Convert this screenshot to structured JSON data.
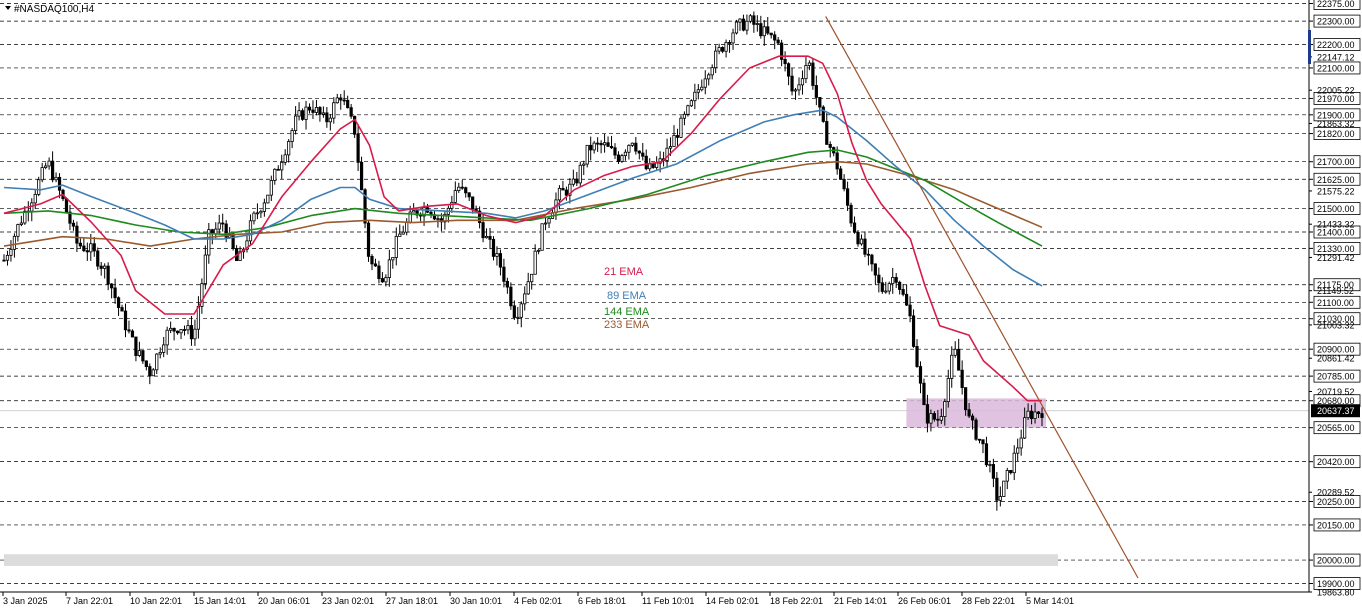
{
  "chart_data": {
    "type": "candlestick",
    "symbol": "#NASDAQ100,H4",
    "ylim": [
      19863.8,
      22390
    ],
    "colors": {
      "background": "#ffffff",
      "candle": "#000000",
      "ema21": "#d81b4a",
      "ema89": "#3f7fb5",
      "ema144": "#1f8a1f",
      "ema233": "#9a5a2e",
      "trendline": "#a0522d",
      "zone": "#d9b8dc",
      "support_band": "#dcdcdc",
      "price_marker": "#000000"
    },
    "x_labels": [
      "3 Jan 2025",
      "7 Jan 22:01",
      "10 Jan 22:01",
      "15 Jan 14:01",
      "20 Jan 06:01",
      "23 Jan 02:01",
      "27 Jan 18:01",
      "30 Jan 10:01",
      "4 Feb 02:01",
      "6 Feb 18:01",
      "11 Feb 10:01",
      "14 Feb 02:01",
      "18 Feb 22:01",
      "21 Feb 14:01",
      "26 Feb 06:01",
      "28 Feb 22:01",
      "5 Mar 14:01"
    ],
    "level_labels": [
      "22375.00",
      "22300.00",
      "22200.00",
      "22100.00",
      "21970.00",
      "21900.00",
      "21820.00",
      "21700.00",
      "21625.00",
      "21500.00",
      "21400.00",
      "21330.00",
      "21175.00",
      "21100.00",
      "21030.00",
      "20900.00",
      "20785.00",
      "20680.00",
      "20565.00",
      "20420.00",
      "20250.00",
      "20150.00",
      "20000.00",
      "19900.00"
    ],
    "tick_labels": [
      "22147.12",
      "22005.22",
      "21863.32",
      "21575.22",
      "21433.32",
      "21291.42",
      "21149.52",
      "21003.32",
      "20861.42",
      "20719.52",
      "20289.52",
      "19863.80"
    ],
    "current_price": "20637.37",
    "legend": [
      {
        "key": "ema21",
        "label": "21 EMA"
      },
      {
        "key": "ema89",
        "label": "89 EMA"
      },
      {
        "key": "ema144",
        "label": "144 EMA"
      },
      {
        "key": "ema233",
        "label": "233 EMA"
      }
    ],
    "close_path": [
      [
        0,
        21280
      ],
      [
        2,
        21430
      ],
      [
        4,
        21560
      ],
      [
        6,
        21700
      ],
      [
        8,
        21540
      ],
      [
        10,
        21350
      ],
      [
        12,
        21320
      ],
      [
        14,
        21230
      ],
      [
        16,
        21050
      ],
      [
        18,
        20900
      ],
      [
        20,
        20800
      ],
      [
        22,
        20960
      ],
      [
        24,
        21000
      ],
      [
        26,
        20960
      ],
      [
        28,
        21380
      ],
      [
        30,
        21440
      ],
      [
        32,
        21260
      ],
      [
        34,
        21450
      ],
      [
        36,
        21560
      ],
      [
        38,
        21720
      ],
      [
        40,
        21880
      ],
      [
        42,
        21940
      ],
      [
        44,
        21870
      ],
      [
        46,
        21990
      ],
      [
        48,
        21830
      ],
      [
        50,
        21270
      ],
      [
        52,
        21210
      ],
      [
        54,
        21380
      ],
      [
        56,
        21480
      ],
      [
        58,
        21510
      ],
      [
        60,
        21440
      ],
      [
        62,
        21600
      ],
      [
        64,
        21520
      ],
      [
        66,
        21370
      ],
      [
        68,
        21250
      ],
      [
        70,
        21040
      ],
      [
        72,
        21220
      ],
      [
        74,
        21450
      ],
      [
        76,
        21560
      ],
      [
        78,
        21600
      ],
      [
        80,
        21760
      ],
      [
        82,
        21770
      ],
      [
        84,
        21720
      ],
      [
        86,
        21800
      ],
      [
        88,
        21660
      ],
      [
        90,
        21700
      ],
      [
        92,
        21820
      ],
      [
        94,
        21940
      ],
      [
        96,
        22080
      ],
      [
        98,
        22180
      ],
      [
        100,
        22270
      ],
      [
        102,
        22300
      ],
      [
        104,
        22250
      ],
      [
        106,
        22200
      ],
      [
        108,
        21980
      ],
      [
        110,
        22140
      ],
      [
        112,
        21850
      ],
      [
        114,
        21680
      ],
      [
        116,
        21440
      ],
      [
        118,
        21290
      ],
      [
        120,
        21150
      ],
      [
        122,
        21220
      ],
      [
        124,
        21030
      ],
      [
        126,
        20610
      ],
      [
        128,
        20600
      ],
      [
        130,
        20900
      ],
      [
        132,
        20600
      ],
      [
        134,
        20480
      ],
      [
        136,
        20250
      ],
      [
        138,
        20420
      ],
      [
        140,
        20620
      ],
      [
        142,
        20637.37
      ]
    ],
    "ema21_path": [
      [
        0,
        21480
      ],
      [
        5,
        21520
      ],
      [
        8,
        21560
      ],
      [
        12,
        21440
      ],
      [
        16,
        21300
      ],
      [
        18,
        21150
      ],
      [
        22,
        21050
      ],
      [
        26,
        21050
      ],
      [
        30,
        21260
      ],
      [
        34,
        21350
      ],
      [
        38,
        21550
      ],
      [
        42,
        21700
      ],
      [
        46,
        21840
      ],
      [
        48,
        21880
      ],
      [
        50,
        21770
      ],
      [
        52,
        21550
      ],
      [
        54,
        21490
      ],
      [
        58,
        21510
      ],
      [
        62,
        21520
      ],
      [
        66,
        21470
      ],
      [
        70,
        21440
      ],
      [
        74,
        21470
      ],
      [
        78,
        21580
      ],
      [
        82,
        21640
      ],
      [
        86,
        21680
      ],
      [
        90,
        21700
      ],
      [
        94,
        21820
      ],
      [
        98,
        21970
      ],
      [
        102,
        22100
      ],
      [
        106,
        22150
      ],
      [
        110,
        22150
      ],
      [
        112,
        22120
      ],
      [
        114,
        21990
      ],
      [
        116,
        21780
      ],
      [
        118,
        21620
      ],
      [
        120,
        21520
      ],
      [
        124,
        21370
      ],
      [
        126,
        21170
      ],
      [
        128,
        21000
      ],
      [
        132,
        20960
      ],
      [
        134,
        20850
      ],
      [
        138,
        20740
      ],
      [
        140,
        20680
      ],
      [
        142,
        20680
      ]
    ],
    "ema89_path": [
      [
        0,
        21590
      ],
      [
        5,
        21580
      ],
      [
        8,
        21600
      ],
      [
        12,
        21550
      ],
      [
        18,
        21480
      ],
      [
        22,
        21430
      ],
      [
        26,
        21370
      ],
      [
        30,
        21370
      ],
      [
        34,
        21390
      ],
      [
        38,
        21450
      ],
      [
        42,
        21540
      ],
      [
        46,
        21590
      ],
      [
        48,
        21590
      ],
      [
        50,
        21540
      ],
      [
        54,
        21500
      ],
      [
        60,
        21490
      ],
      [
        66,
        21480
      ],
      [
        70,
        21460
      ],
      [
        74,
        21490
      ],
      [
        80,
        21560
      ],
      [
        86,
        21630
      ],
      [
        92,
        21690
      ],
      [
        98,
        21790
      ],
      [
        104,
        21870
      ],
      [
        108,
        21900
      ],
      [
        112,
        21920
      ],
      [
        114,
        21890
      ],
      [
        118,
        21790
      ],
      [
        122,
        21680
      ],
      [
        126,
        21580
      ],
      [
        130,
        21450
      ],
      [
        134,
        21340
      ],
      [
        138,
        21240
      ],
      [
        142,
        21170
      ]
    ],
    "ema144_path": [
      [
        0,
        21480
      ],
      [
        6,
        21490
      ],
      [
        12,
        21470
      ],
      [
        18,
        21430
      ],
      [
        24,
        21400
      ],
      [
        30,
        21390
      ],
      [
        36,
        21420
      ],
      [
        42,
        21470
      ],
      [
        48,
        21500
      ],
      [
        54,
        21480
      ],
      [
        60,
        21470
      ],
      [
        66,
        21460
      ],
      [
        72,
        21450
      ],
      [
        80,
        21500
      ],
      [
        88,
        21560
      ],
      [
        96,
        21640
      ],
      [
        104,
        21700
      ],
      [
        110,
        21740
      ],
      [
        114,
        21750
      ],
      [
        118,
        21720
      ],
      [
        122,
        21670
      ],
      [
        126,
        21620
      ],
      [
        132,
        21510
      ],
      [
        136,
        21440
      ],
      [
        142,
        21340
      ]
    ],
    "ema233_path": [
      [
        0,
        21340
      ],
      [
        8,
        21380
      ],
      [
        14,
        21370
      ],
      [
        20,
        21340
      ],
      [
        26,
        21370
      ],
      [
        32,
        21390
      ],
      [
        38,
        21400
      ],
      [
        44,
        21440
      ],
      [
        50,
        21450
      ],
      [
        56,
        21440
      ],
      [
        62,
        21450
      ],
      [
        70,
        21450
      ],
      [
        78,
        21500
      ],
      [
        86,
        21540
      ],
      [
        94,
        21590
      ],
      [
        102,
        21650
      ],
      [
        110,
        21690
      ],
      [
        114,
        21700
      ],
      [
        118,
        21690
      ],
      [
        124,
        21640
      ],
      [
        130,
        21580
      ],
      [
        136,
        21500
      ],
      [
        142,
        21420
      ]
    ],
    "trendline": [
      [
        112,
        22320
      ],
      [
        153,
        19863.8
      ]
    ],
    "zone": {
      "x0": 124,
      "x1": 142,
      "y0": 20565,
      "y1": 20690
    },
    "support_band": {
      "x0": 0,
      "x1": 142,
      "y0": 19975,
      "y1": 20025
    }
  }
}
